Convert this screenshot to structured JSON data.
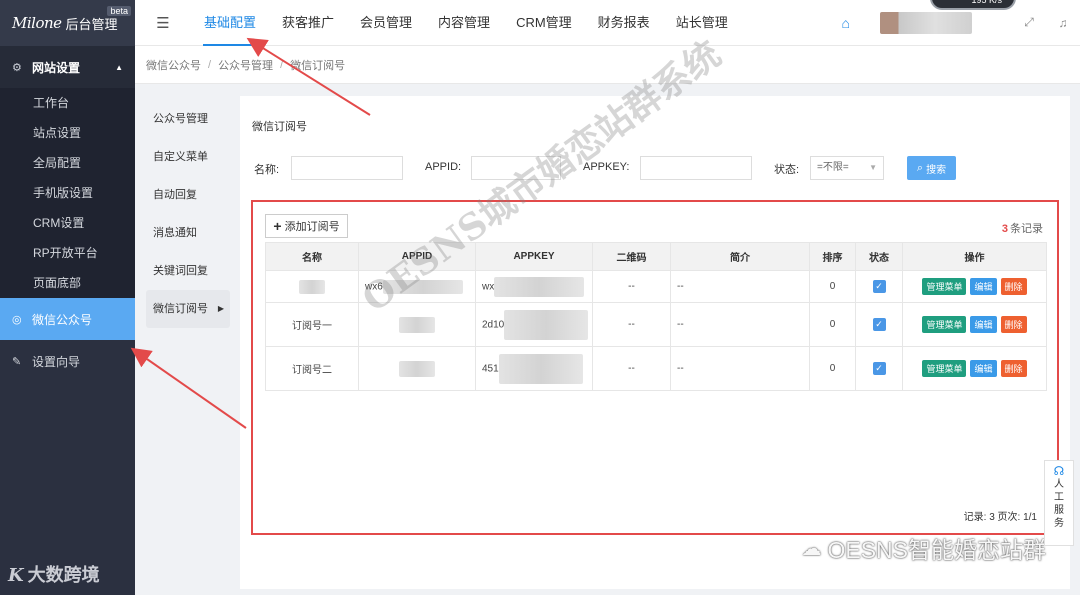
{
  "sidebar": {
    "logo_script": "Milone",
    "logo_text": "后台管理",
    "beta": "beta",
    "group_label": "网站设置",
    "group_items": [
      "工作台",
      "站点设置",
      "全局配置",
      "手机版设置",
      "CRM设置",
      "RP开放平台",
      "页面底部"
    ],
    "active_label": "微信公众号",
    "wizard_label": "设置向导",
    "footer_logo": "K",
    "footer_text": "大数跨境"
  },
  "topnav": {
    "items": [
      "基础配置",
      "获客推广",
      "会员管理",
      "内容管理",
      "CRM管理",
      "财务报表",
      "站长管理"
    ],
    "active_index": 0,
    "speed": "195 K/s"
  },
  "breadcrumb": [
    "微信公众号",
    "公众号管理",
    "微信订阅号"
  ],
  "submenu": {
    "items": [
      "公众号管理",
      "自定义菜单",
      "自动回复",
      "消息通知",
      "关键词回复",
      "微信订阅号"
    ],
    "active_index": 5
  },
  "panel": {
    "title": "微信订阅号",
    "filter": {
      "name_label": "名称:",
      "appid_label": "APPID:",
      "appkey_label": "APPKEY:",
      "status_label": "状态:",
      "status_value": "=不限=",
      "search_label": "搜索"
    },
    "add_label": "添加订阅号",
    "record_count": "3",
    "record_suffix": "条记录",
    "columns": [
      "名称",
      "APPID",
      "APPKEY",
      "二维码",
      "简介",
      "排序",
      "状态",
      "操作"
    ],
    "rows": [
      {
        "name": "",
        "appid": "wx6",
        "appkey": "wx",
        "qrcode": "--",
        "intro": "--",
        "sort": "0"
      },
      {
        "name": "订阅号一",
        "appid": "",
        "appkey": "2d10",
        "qrcode": "--",
        "intro": "--",
        "sort": "0"
      },
      {
        "name": "订阅号二",
        "appid": "",
        "appkey": "451",
        "qrcode": "--",
        "intro": "--",
        "sort": "0"
      }
    ],
    "ops": {
      "menu": "管理菜单",
      "edit": "编辑",
      "delete": "删除"
    },
    "pager": "记录: 3  页次: 1/1"
  },
  "watermark": "OESNS城市婚恋站群系统",
  "footer_watermark": "OESNS智能婚恋站群",
  "service": [
    "人",
    "工",
    "服",
    "务"
  ],
  "colors": {
    "accent": "#1e88e5",
    "sidebar_bg": "#2b3040",
    "active_bg": "#5aa9f2",
    "highlight_box": "#e34a4a"
  }
}
